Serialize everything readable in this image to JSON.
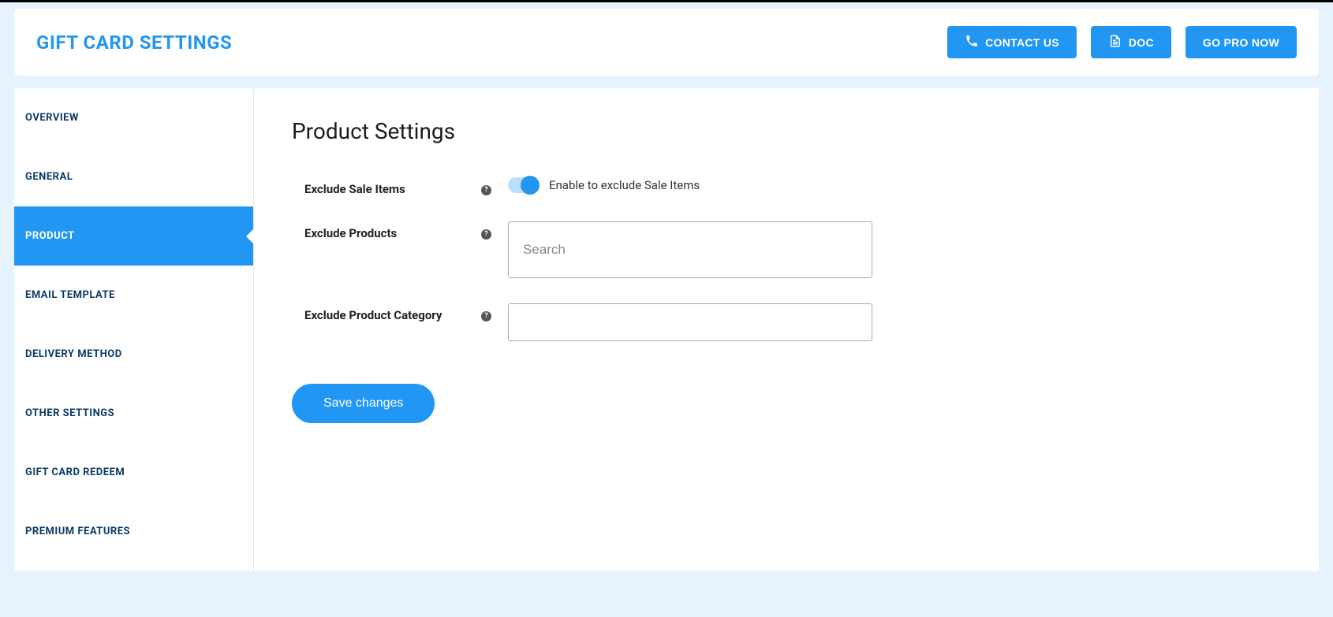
{
  "header": {
    "title": "GIFT CARD SETTINGS",
    "buttons": {
      "contact": "CONTACT US",
      "doc": "DOC",
      "pro": "GO PRO NOW"
    }
  },
  "sidebar": {
    "items": [
      {
        "label": "OVERVIEW"
      },
      {
        "label": "GENERAL"
      },
      {
        "label": "PRODUCT"
      },
      {
        "label": "EMAIL TEMPLATE"
      },
      {
        "label": "DELIVERY METHOD"
      },
      {
        "label": "OTHER SETTINGS"
      },
      {
        "label": "GIFT CARD REDEEM"
      },
      {
        "label": "PREMIUM FEATURES"
      }
    ],
    "activeIndex": 2
  },
  "content": {
    "sectionTitle": "Product Settings",
    "rows": {
      "excludeSale": {
        "label": "Exclude Sale Items",
        "toggleLabel": "Enable to exclude Sale Items",
        "enabled": true
      },
      "excludeProducts": {
        "label": "Exclude Products",
        "placeholder": "Search"
      },
      "excludeCategory": {
        "label": "Exclude Product Category"
      }
    },
    "saveLabel": "Save changes"
  }
}
